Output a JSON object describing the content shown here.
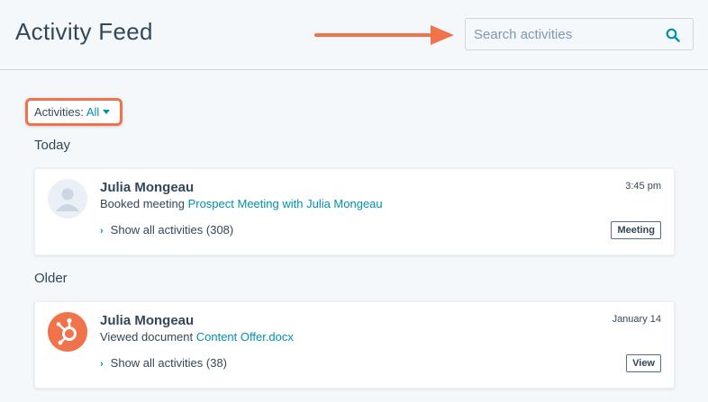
{
  "header": {
    "title": "Activity Feed",
    "search_placeholder": "Search activities"
  },
  "filter": {
    "label": "Activities:",
    "value": "All"
  },
  "sections": [
    {
      "heading": "Today",
      "card": {
        "name": "Julia Mongeau",
        "action": "Booked meeting",
        "link": "Prospect Meeting with Julia Mongeau",
        "time": "3:45 pm",
        "show_all": "Show all activities (308)",
        "tag": "Meeting",
        "avatar": "person-avatar-icon"
      }
    },
    {
      "heading": "Older",
      "card": {
        "name": "Julia Mongeau",
        "action": "Viewed document",
        "link": "Content Offer.docx",
        "time": "January 14",
        "show_all": "Show all activities (38)",
        "tag": "View",
        "avatar": "hubspot-sprocket-icon"
      }
    }
  ],
  "colors": {
    "accent": "#0091ae",
    "highlight": "#f0734b",
    "text": "#33475b",
    "background": "#f5f8fa"
  }
}
